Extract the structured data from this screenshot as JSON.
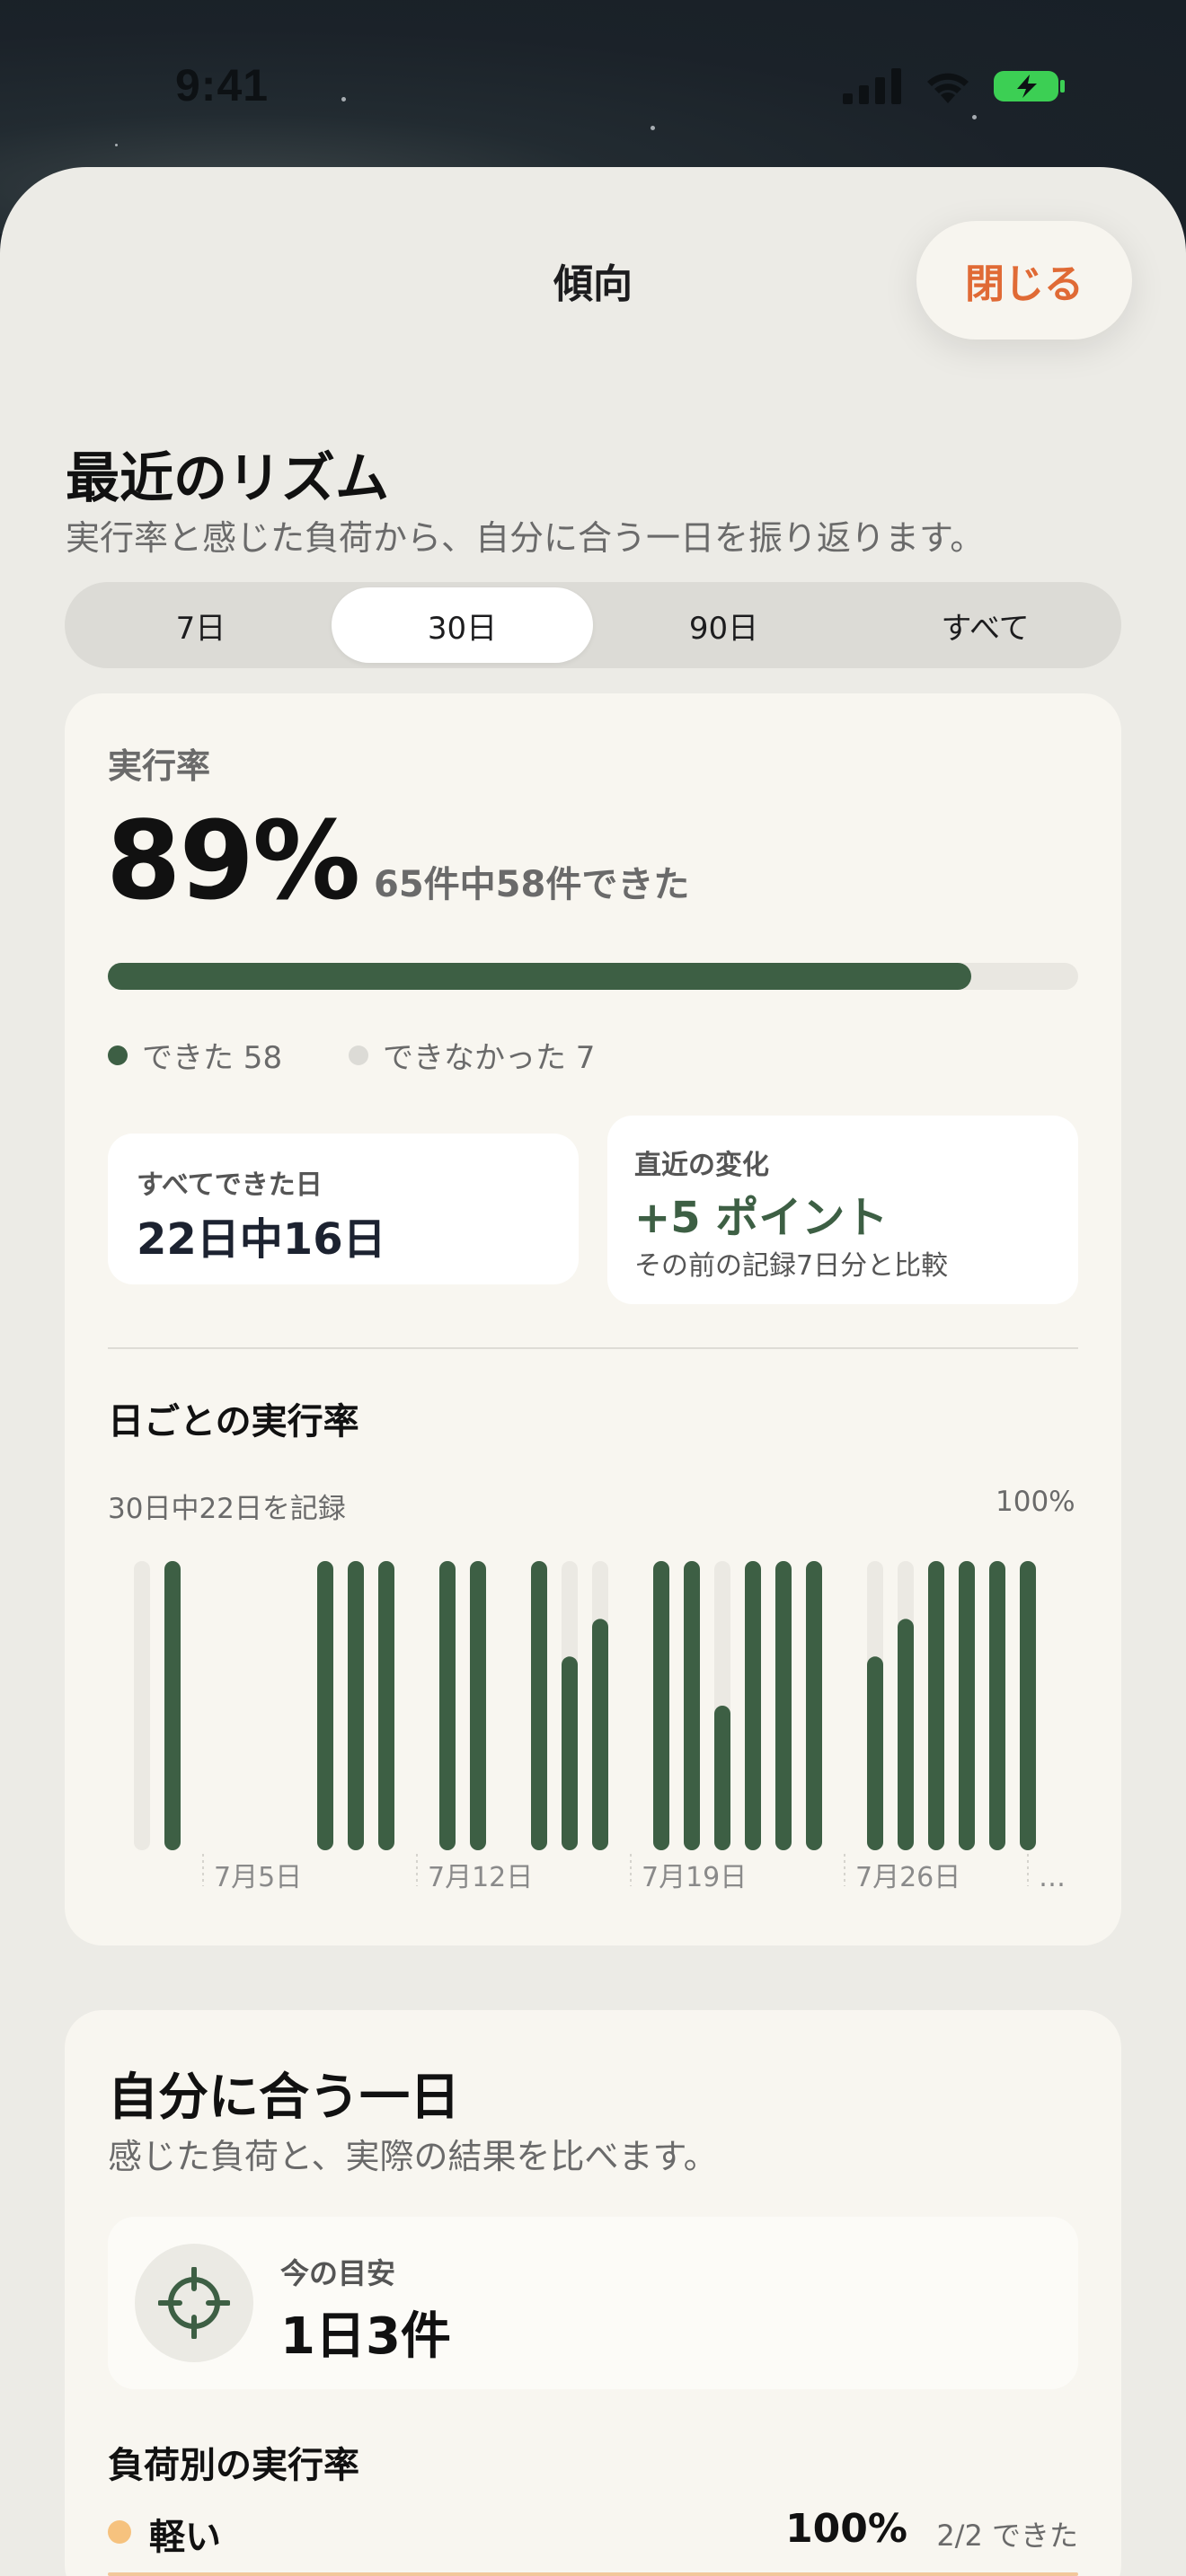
{
  "status_bar": {
    "time": "9:41"
  },
  "header": {
    "title": "傾向",
    "close_label": "閉じる"
  },
  "rhythm": {
    "title": "最近のリズム",
    "subtitle": "実行率と感じた負荷から、自分に合う一日を振り返ります。",
    "periods": [
      "7日",
      "30日",
      "90日",
      "すべて"
    ],
    "selected_period": "30日"
  },
  "completion": {
    "label": "実行率",
    "rate": "89%",
    "detail": "65件中58件できた",
    "progress_fraction": 0.89,
    "legend_done": "できた 58",
    "legend_missed": "できなかった 7",
    "all_done_label": "すべてできた日",
    "all_done_value": "22日中16日",
    "change_label": "直近の変化",
    "change_value": "+5 ポイント",
    "change_note": "その前の記録7日分と比較"
  },
  "colors": {
    "accent": "#3d5f44",
    "close": "#e06a35",
    "light_load": "#f6c27e"
  },
  "chart_data": {
    "type": "bar",
    "title": "日ごとの実行率",
    "note_left": "30日中22日を記録",
    "note_right": "100%",
    "ylim": [
      0,
      100
    ],
    "x_tick_labels": [
      "7月5日",
      "7月12日",
      "7月19日",
      "7月26日",
      "…"
    ],
    "categories": [
      "d1",
      "d2",
      "d3",
      "d4",
      "d5",
      "d6",
      "d7",
      "d8",
      "d9",
      "d10",
      "d11",
      "d12",
      "d13",
      "d14",
      "d15",
      "d16",
      "d17",
      "d18",
      "d19",
      "d20",
      "d21",
      "d22",
      "d23",
      "d24",
      "d25",
      "d26",
      "d27",
      "d28",
      "d29",
      "d30"
    ],
    "values": [
      0,
      100,
      null,
      null,
      null,
      null,
      100,
      100,
      100,
      null,
      100,
      100,
      null,
      100,
      67,
      80,
      null,
      100,
      100,
      50,
      100,
      100,
      100,
      null,
      67,
      80,
      100,
      100,
      100,
      100
    ],
    "recorded": [
      true,
      true,
      false,
      false,
      false,
      false,
      true,
      true,
      true,
      false,
      true,
      true,
      false,
      true,
      true,
      true,
      false,
      true,
      true,
      true,
      true,
      true,
      true,
      false,
      true,
      true,
      true,
      true,
      true,
      true
    ]
  },
  "fit_day": {
    "title": "自分に合う一日",
    "subtitle": "感じた負荷と、実際の結果を比べます。",
    "target_label": "今の目安",
    "target_value": "1日3件",
    "target_icon": "crosshair-icon"
  },
  "load_rates": {
    "title": "負荷別の実行率",
    "rows": [
      {
        "name": "軽い",
        "rate": "100%",
        "count": "2/2 できた"
      }
    ]
  }
}
